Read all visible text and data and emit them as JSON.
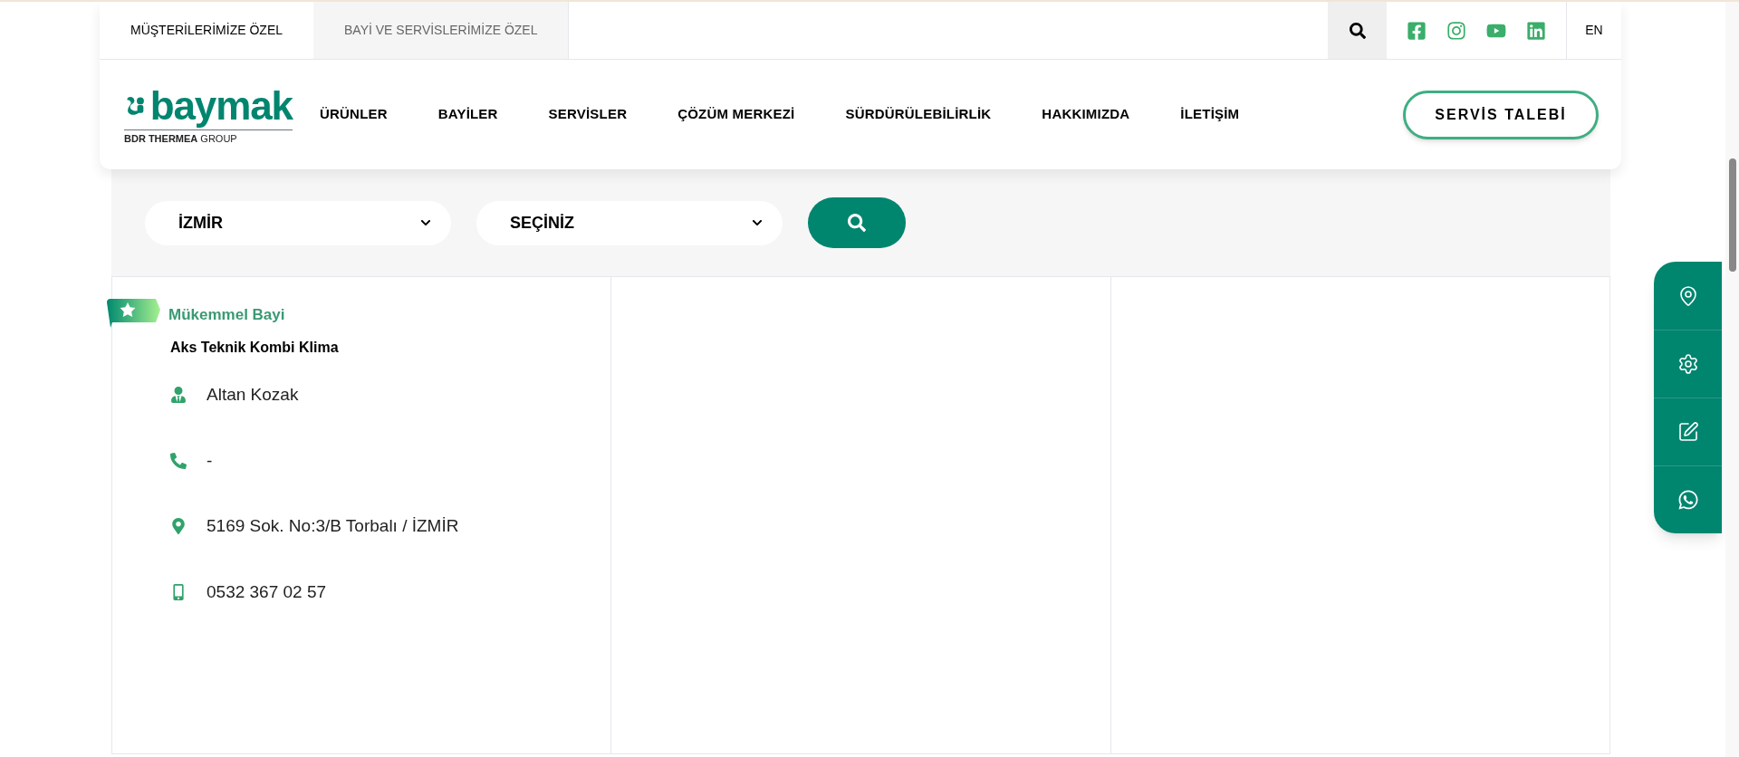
{
  "top_tabs": [
    {
      "label": "MÜŞTERİLERİMİZE ÖZEL",
      "selected": true
    },
    {
      "label": "BAYİ VE SERVİSLERİMİZE ÖZEL",
      "selected": false
    }
  ],
  "socials": [
    {
      "kind": "facebook"
    },
    {
      "kind": "instagram"
    },
    {
      "kind": "youtube"
    },
    {
      "kind": "linkedin"
    }
  ],
  "language": "EN",
  "logo": {
    "wordmark": "baymak",
    "group_bold": "BDR THERMEA",
    "group_light": "GROUP"
  },
  "nav": [
    "ÜRÜNLER",
    "BAYİLER",
    "SERVİSLER",
    "ÇÖZÜM MERKEZİ",
    "SÜRDÜRÜLEBİLİRLİK",
    "HAKKIMIZDA",
    "İLETİŞİM"
  ],
  "cta": "SERVİS TALEBİ",
  "filters": [
    {
      "value": "İZMİR"
    },
    {
      "value": "SEÇİNİZ"
    }
  ],
  "dealers": [
    {
      "badge": "Mükemmel Bayi",
      "name": "Aks Teknik Kombi Klima",
      "contacts": [
        {
          "kind": "person",
          "text": "Altan Kozak"
        },
        {
          "kind": "phone",
          "text": "-"
        },
        {
          "kind": "address",
          "text": "5169 Sok. No:3/B Torbalı / İZMİR"
        },
        {
          "kind": "mobile",
          "text": "0532 367 02 57"
        }
      ]
    }
  ],
  "side_actions": [
    {
      "kind": "location"
    },
    {
      "kind": "service"
    },
    {
      "kind": "form"
    },
    {
      "kind": "whatsapp"
    }
  ]
}
